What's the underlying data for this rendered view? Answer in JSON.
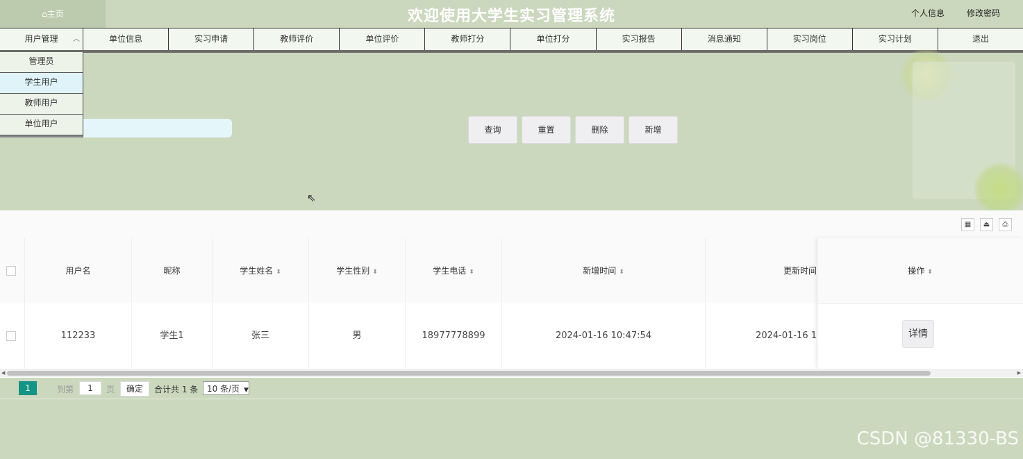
{
  "header": {
    "home_label": "⌂主页",
    "title": "欢迎使用大学生实习管理系统",
    "profile_link": "个人信息",
    "password_link": "修改密码"
  },
  "nav": {
    "items": [
      "用户管理",
      "单位信息",
      "实习申请",
      "教师评价",
      "单位评价",
      "教师打分",
      "单位打分",
      "实习报告",
      "消息通知",
      "实习岗位",
      "实习计划",
      "退出"
    ]
  },
  "dropdown": {
    "items": [
      "管理员",
      "学生用户",
      "教师用户",
      "单位用户"
    ],
    "active_index": 1
  },
  "search": {
    "placeholder": "",
    "value": ""
  },
  "actions": {
    "query": "查询",
    "reset": "重置",
    "delete": "删除",
    "add": "新增"
  },
  "table": {
    "columns": [
      "用户名",
      "昵称",
      "学生姓名",
      "学生性别",
      "学生电话",
      "新增时间",
      "更新时间",
      "操作"
    ],
    "rows": [
      {
        "username": "112233",
        "nickname": "学生1",
        "name": "张三",
        "gender": "男",
        "phone": "18977778899",
        "created": "2024-01-16 10:47:54",
        "updated": "2024-01-16 1"
      }
    ],
    "detail_label": "详情"
  },
  "pagination": {
    "current_page": "1",
    "goto_label": "到第",
    "goto_value": "1",
    "page_unit": "页",
    "confirm": "确定",
    "total": "合计共 1 条",
    "page_size": "10 条/页"
  },
  "watermark": "CSDN @81330-BS"
}
